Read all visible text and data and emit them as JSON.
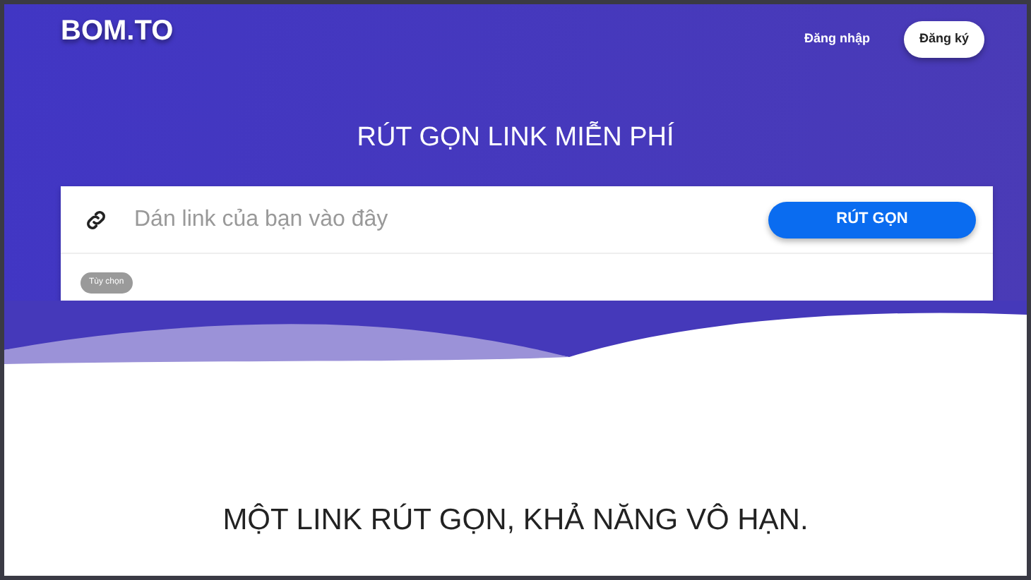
{
  "brand": "BOM.TO",
  "nav": {
    "login": "Đăng nhập",
    "signup": "Đăng ký"
  },
  "hero": {
    "title": "RÚT GỌN LINK MIỄN PHÍ",
    "url_field": {
      "placeholder": "Dán link của bạn vào đây"
    },
    "submit": "RÚT GỌN",
    "options": "Tùy chọn"
  },
  "tagline": "MỘT LINK RÚT GỌN, KHẢ NĂNG VÔ HẠN."
}
